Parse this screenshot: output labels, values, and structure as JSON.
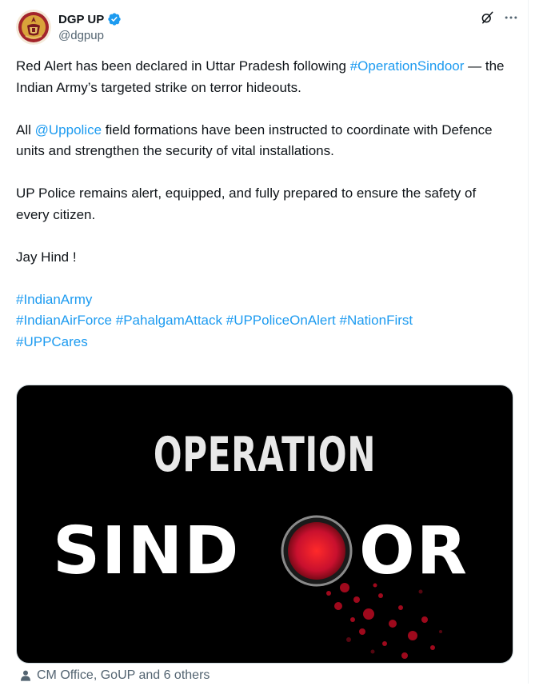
{
  "author": {
    "display_name": "DGP UP",
    "handle": "@dgpup",
    "verified": true
  },
  "colors": {
    "link": "#1d9bf0",
    "text": "#0f1419",
    "secondary": "#536471",
    "sindoor_red": "#c8102e"
  },
  "tweet": {
    "p1_text": "Red Alert has been declared in Uttar Pradesh following ",
    "p1_hashtag": "#OperationSindoor",
    "p1_rest": " — the Indian Army’s targeted strike on terror hideouts.",
    "p2_prefix": "All ",
    "p2_mention": "@Uppolice",
    "p2_rest": " field formations have been instructed to coordinate with Defence units and strengthen the security of vital installations.",
    "p3": "UP Police remains alert, equipped, and fully prepared to ensure the safety of every citizen.",
    "p4": "Jay Hind !",
    "hashtags_line1": [
      "#IndianArmy"
    ],
    "hashtags_line2": [
      "#IndianAirForce",
      "#PahalgamAttack",
      "#UPPoliceOnAlert",
      "#NationFirst"
    ],
    "hashtags_line3": [
      "#UPPCares"
    ]
  },
  "media": {
    "line1": "OPERATION",
    "line2_left": "SIND",
    "line2_right": "OR"
  },
  "footer": {
    "tagged_text": "CM Office, GoUP and 6 others"
  },
  "icons": {
    "verified": "verified-badge-icon",
    "grok": "grok-icon",
    "more": "more-icon",
    "person": "person-icon"
  }
}
